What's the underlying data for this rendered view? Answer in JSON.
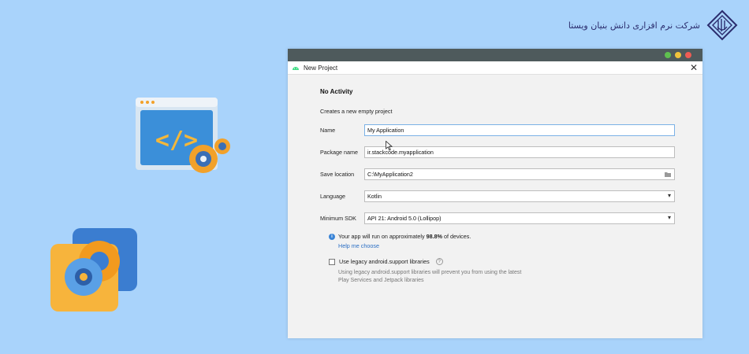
{
  "brand": {
    "name": "شرکت نرم افزاری دانش بنیان ویستا",
    "logo_icon": "vista-logo-icon"
  },
  "illustrations": {
    "code_window": "code-window-icon",
    "settings_gear": "settings-gear-icon"
  },
  "window": {
    "title": "New Project",
    "app_icon": "android-icon",
    "controls": {
      "colors": [
        "#5fc04f",
        "#f0c23b",
        "#ee5c54"
      ]
    },
    "close_label": "✕"
  },
  "form": {
    "heading": "No Activity",
    "description": "Creates a new empty project",
    "fields": {
      "name": {
        "label": "Name",
        "value": "My Application"
      },
      "package": {
        "label": "Package name",
        "value": "ir.stackcode.myapplication"
      },
      "save_location": {
        "label": "Save location",
        "value": "C:\\MyApplication2"
      },
      "language": {
        "label": "Language",
        "value": "Kotlin"
      },
      "min_sdk": {
        "label": "Minimum SDK",
        "value": "API 21: Android 5.0 (Lollipop)"
      }
    },
    "info": {
      "prefix": "Your app will run on approximately ",
      "percent": "98.8%",
      "suffix": " of devices.",
      "help_link": "Help me choose"
    },
    "legacy": {
      "label": "Use legacy android.support libraries",
      "checked": false,
      "note": "Using legacy android.support libraries will prevent you from using the latest Play Services and Jetpack libraries"
    }
  }
}
